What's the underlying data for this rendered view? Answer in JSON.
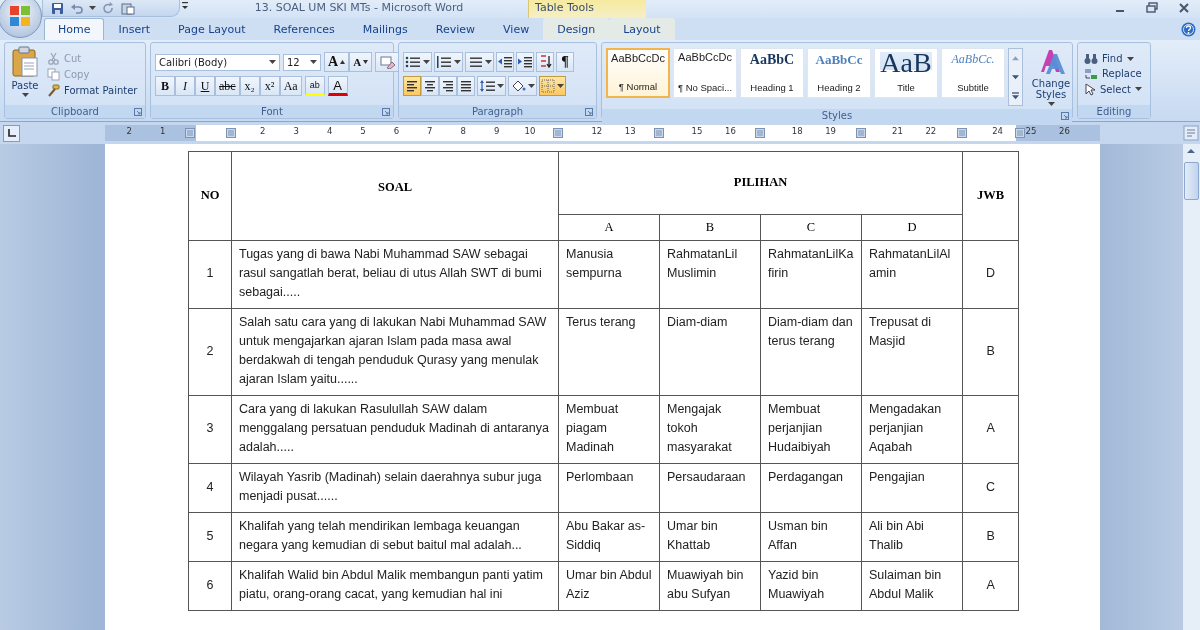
{
  "window": {
    "title": "13. SOAL UM SKI MTs - Microsoft Word",
    "context_group": "Table Tools"
  },
  "tabs": [
    {
      "label": "Home",
      "selected": true,
      "kind": "main"
    },
    {
      "label": "Insert",
      "selected": false,
      "kind": "main"
    },
    {
      "label": "Page Layout",
      "selected": false,
      "kind": "main"
    },
    {
      "label": "References",
      "selected": false,
      "kind": "main"
    },
    {
      "label": "Mailings",
      "selected": false,
      "kind": "main"
    },
    {
      "label": "Review",
      "selected": false,
      "kind": "main"
    },
    {
      "label": "View",
      "selected": false,
      "kind": "main"
    },
    {
      "label": "Design",
      "selected": false,
      "kind": "context"
    },
    {
      "label": "Layout",
      "selected": false,
      "kind": "context"
    }
  ],
  "clipboard": {
    "label": "Clipboard",
    "paste": "Paste",
    "actions": [
      {
        "label": "Cut",
        "kind": "cut",
        "disabled": true
      },
      {
        "label": "Copy",
        "kind": "copy",
        "disabled": true
      },
      {
        "label": "Format Painter",
        "kind": "painter",
        "disabled": false
      }
    ]
  },
  "font": {
    "label": "Font",
    "family": "Calibri (Body)",
    "size": "12",
    "size_buttons": [
      "A",
      "A"
    ],
    "format_buttons": [
      {
        "kind": "bold",
        "text": "B"
      },
      {
        "kind": "italic",
        "text": "I"
      },
      {
        "kind": "underline",
        "text": "U"
      },
      {
        "kind": "strike",
        "text": "abc"
      },
      {
        "kind": "plain",
        "text": "x₂"
      },
      {
        "kind": "plain",
        "text": "x²"
      },
      {
        "kind": "plain",
        "text": "Aa"
      }
    ],
    "color_buttons": [
      {
        "kind": "highlight",
        "text": "ab"
      },
      {
        "kind": "font_color",
        "text": "A"
      }
    ]
  },
  "paragraph": {
    "label": "Paragraph",
    "show_marks": "¶",
    "alignments": [
      {
        "kind": "left",
        "selected": true
      },
      {
        "kind": "center",
        "selected": false
      },
      {
        "kind": "right",
        "selected": false
      },
      {
        "kind": "justify",
        "selected": false
      }
    ],
    "borders": {
      "selected": true
    }
  },
  "styles": {
    "label": "Styles",
    "change_styles": "Change Styles",
    "items": [
      {
        "preview": "AaBbCcDc",
        "name": "¶ Normal",
        "kind": "normal",
        "selected": true
      },
      {
        "preview": "AaBbCcDc",
        "name": "¶ No Spaci...",
        "kind": "normal",
        "selected": false
      },
      {
        "preview": "AaBbC",
        "name": "Heading 1",
        "kind": "heading1",
        "selected": false
      },
      {
        "preview": "AaBbCc",
        "name": "Heading 2",
        "kind": "heading2",
        "selected": false
      },
      {
        "preview": "AaB",
        "name": "Title",
        "kind": "title",
        "selected": false
      },
      {
        "preview": "AaBbCc.",
        "name": "Subtitle",
        "kind": "subtitle",
        "selected": false
      }
    ]
  },
  "editing": {
    "label": "Editing",
    "actions": [
      {
        "label": "Find",
        "kind": "find"
      },
      {
        "label": "Replace",
        "kind": "replace"
      },
      {
        "label": "Select",
        "kind": "select"
      }
    ]
  },
  "ruler": {
    "left_numbers": [
      "2",
      "1"
    ],
    "numbers": [
      "2",
      "3",
      "4",
      "5",
      "6",
      "7",
      "8",
      "9",
      "10",
      "12",
      "13",
      "15",
      "16",
      "18",
      "19",
      "21",
      "22",
      "24",
      "25",
      "26"
    ]
  },
  "table": {
    "headers": {
      "no": "NO",
      "question": "SOAL",
      "options": "PILIHAN",
      "answer": "JWB"
    },
    "option_columns": [
      "A",
      "B",
      "C",
      "D"
    ],
    "rows": [
      {
        "no": "1",
        "question": "Tugas yang di bawa Nabi Muhammad SAW sebagai rasul sangatlah berat, beliau di utus Allah SWT di bumi sebagai.....",
        "options": [
          "Manusia sempurna",
          "RahmatanLil Muslimin",
          "RahmatanLilKa firin",
          "RahmatanLilAl amin"
        ],
        "answer": "D"
      },
      {
        "no": "2",
        "question": "Salah satu cara yang di lakukan Nabi Muhammad SAW untuk mengajarkan ajaran Islam pada masa awal berdakwah di tengah penduduk Qurasy yang menulak ajaran Islam yaitu......",
        "options": [
          "Terus terang",
          "Diam-diam",
          "Diam-diam dan terus terang",
          "Trepusat di Masjid"
        ],
        "answer": "B"
      },
      {
        "no": "3",
        "question": "Cara yang di lakukan Rasulullah SAW dalam menggalang persatuan penduduk Madinah di antaranya adalah.....",
        "options": [
          "Membuat piagam Madinah",
          "Mengajak tokoh masyarakat",
          "Membuat perjanjian Hudaibiyah",
          "Mengadakan perjanjian Aqabah"
        ],
        "answer": "A"
      },
      {
        "no": "4",
        "question": "Wilayah Yasrib (Madinah) selain daerahnya subur juga menjadi pusat......",
        "options": [
          "Perlombaan",
          "Persaudaraan",
          "Perdagangan",
          "Pengajian"
        ],
        "answer": "C"
      },
      {
        "no": "5",
        "question": "Khalifah yang telah mendirikan lembaga keuangan negara yang kemudian di sebut baitul mal adalah...",
        "options": [
          "Abu Bakar as-Siddiq",
          "Umar bin Khattab",
          "Usman bin Affan",
          "Ali bin Abi Thalib"
        ],
        "answer": "B"
      },
      {
        "no": "6",
        "question": "Khalifah Walid bin Abdul Malik membangun panti yatim piatu, orang-orang cacat, yang kemudian hal ini",
        "options": [
          "Umar bin Abdul Aziz",
          "Muawiyah bin abu Sufyan",
          "Yazid bin Muawiyah",
          "Sulaiman bin Abdul Malik"
        ],
        "answer": "A"
      }
    ]
  }
}
